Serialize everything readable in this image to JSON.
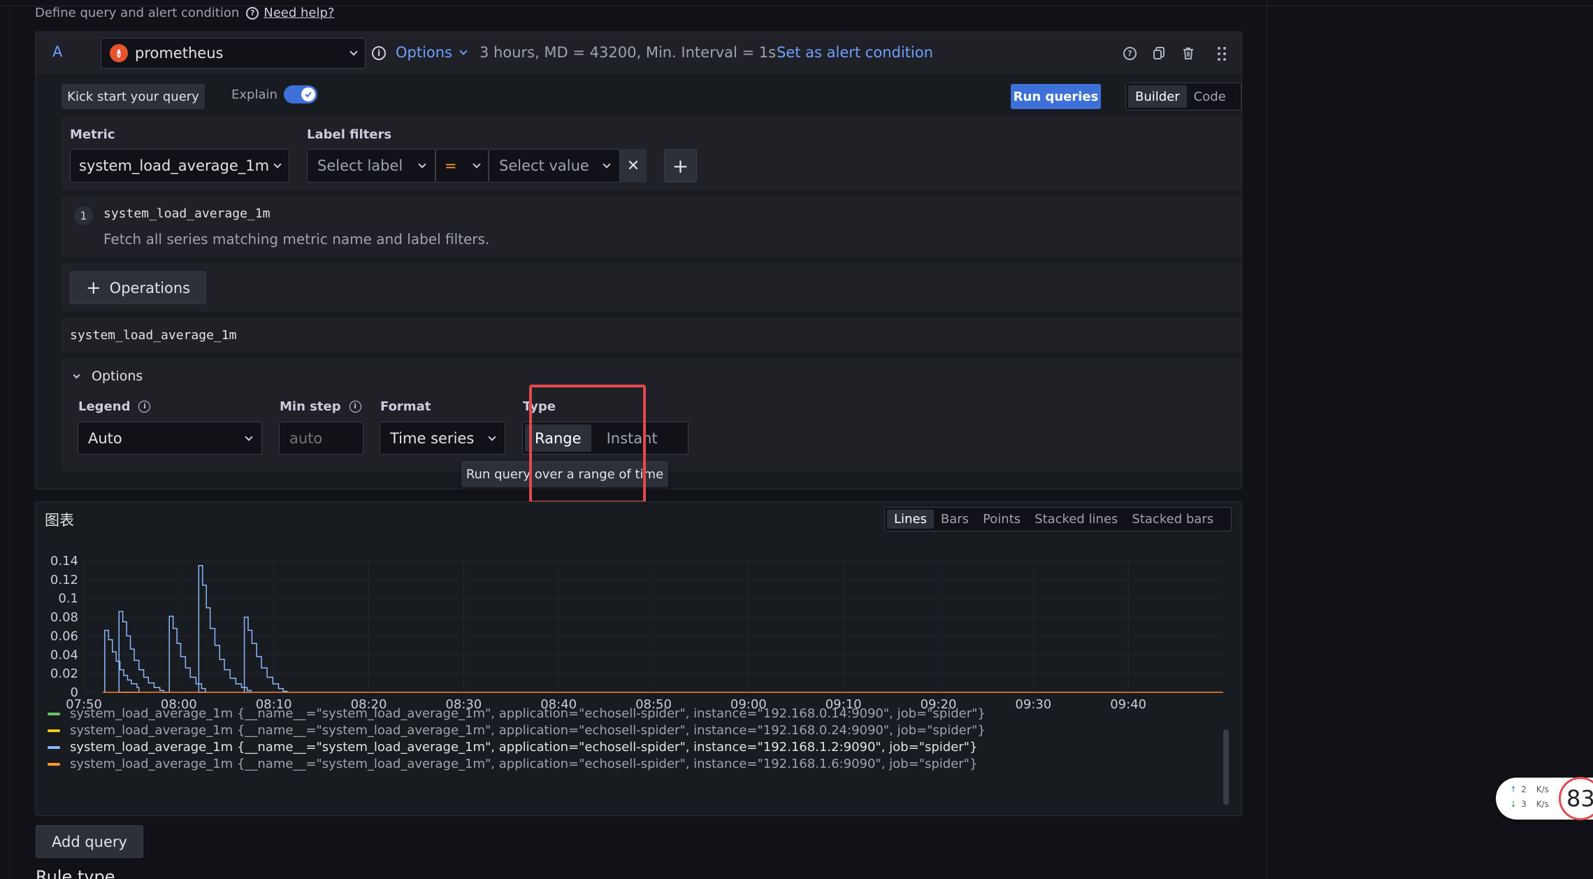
{
  "header": {
    "subtitle": "Define query and alert condition",
    "help_link": "Need help?"
  },
  "query": {
    "ref_id": "A",
    "datasource": "prometheus",
    "options_label": "Options",
    "options_summary": "3 hours, MD = 43200, Min. Interval = 1s",
    "alert_link": "Set as alert condition",
    "kickstart": "Kick start your query",
    "explain": "Explain",
    "run_queries": "Run queries",
    "builder": "Builder",
    "code": "Code",
    "metric_label": "Metric",
    "metric_value": "system_load_average_1m",
    "label_filters_label": "Label filters",
    "select_label": "Select label",
    "operator": "=",
    "select_value": "Select value",
    "explain_step_num": "1",
    "explain_step_code": "system_load_average_1m",
    "explain_step_desc": "Fetch all series matching metric name and label filters.",
    "operations": "Operations",
    "raw_query": "system_load_average_1m",
    "options_section": "Options",
    "legend_label": "Legend",
    "legend_value": "Auto",
    "minstep_label": "Min step",
    "minstep_placeholder": "auto",
    "format_label": "Format",
    "format_value": "Time series",
    "type_label": "Type",
    "type_range": "Range",
    "type_instant": "Instant",
    "tooltip": "Run query over a range of time"
  },
  "graph": {
    "title": "图表",
    "modes": [
      "Lines",
      "Bars",
      "Points",
      "Stacked lines",
      "Stacked bars"
    ],
    "active_mode": "Lines"
  },
  "chart_data": {
    "type": "line",
    "title": "",
    "xlabel": "",
    "ylabel": "",
    "ylim": [
      0,
      0.14
    ],
    "yticks": [
      "0.14",
      "0.12",
      "0.1",
      "0.08",
      "0.06",
      "0.04",
      "0.02",
      "0"
    ],
    "xticks": [
      "07:50",
      "08:00",
      "08:10",
      "08:20",
      "08:30",
      "08:40",
      "08:50",
      "09:00",
      "09:10",
      "09:20",
      "09:30",
      "09:40"
    ],
    "xrange_minutes": [
      0,
      120
    ],
    "series": [
      {
        "name": "system_load_average_1m {__name__=\"system_load_average_1m\", application=\"echosell-spider\", instance=\"192.168.1.2:9090\", job=\"spider\"}",
        "color": "#8ab8ff",
        "points": [
          [
            2.1,
            0
          ],
          [
            2.2,
            0.066
          ],
          [
            2.6,
            0.056
          ],
          [
            3.0,
            0.043
          ],
          [
            3.4,
            0.033
          ],
          [
            3.8,
            0.024
          ],
          [
            4.2,
            0.018
          ],
          [
            4.6,
            0.013
          ],
          [
            5.0,
            0.009
          ],
          [
            5.6,
            0.005
          ],
          [
            5.8,
            0
          ],
          [
            3.6,
            0
          ],
          [
            3.7,
            0.086
          ],
          [
            4.1,
            0.075
          ],
          [
            4.5,
            0.06
          ],
          [
            4.9,
            0.046
          ],
          [
            5.3,
            0.034
          ],
          [
            5.8,
            0.024
          ],
          [
            6.3,
            0.016
          ],
          [
            6.8,
            0.01
          ],
          [
            7.4,
            0.005
          ],
          [
            8.0,
            0.002
          ],
          [
            8.4,
            0
          ],
          [
            8.9,
            0
          ],
          [
            9.0,
            0.081
          ],
          [
            9.4,
            0.068
          ],
          [
            9.8,
            0.052
          ],
          [
            10.2,
            0.038
          ],
          [
            10.7,
            0.026
          ],
          [
            11.2,
            0.016
          ],
          [
            11.8,
            0.009
          ],
          [
            12.4,
            0.004
          ],
          [
            12.8,
            0
          ],
          [
            12.0,
            0
          ],
          [
            12.1,
            0.135
          ],
          [
            12.5,
            0.114
          ],
          [
            12.9,
            0.09
          ],
          [
            13.3,
            0.068
          ],
          [
            13.8,
            0.05
          ],
          [
            14.3,
            0.035
          ],
          [
            14.8,
            0.024
          ],
          [
            15.4,
            0.015
          ],
          [
            16.0,
            0.009
          ],
          [
            16.6,
            0.005
          ],
          [
            17.2,
            0.002
          ],
          [
            17.6,
            0
          ],
          [
            16.8,
            0
          ],
          [
            16.9,
            0.08
          ],
          [
            17.3,
            0.066
          ],
          [
            17.7,
            0.052
          ],
          [
            18.2,
            0.038
          ],
          [
            18.7,
            0.026
          ],
          [
            19.3,
            0.016
          ],
          [
            19.9,
            0.009
          ],
          [
            20.5,
            0.004
          ],
          [
            21.0,
            0.001
          ],
          [
            21.4,
            0
          ]
        ]
      },
      {
        "name": "system_load_average_1m {__name__=\"system_load_average_1m\", application=\"echosell-spider\", instance=\"192.168.1.6:9090\", job=\"spider\"}",
        "color": "#ff7f2a",
        "points": [
          [
            2,
            0
          ],
          [
            120,
            0
          ]
        ]
      }
    ]
  },
  "legend": [
    {
      "text": "system_load_average_1m {__name__=\"system_load_average_1m\", application=\"echosell-spider\", instance=\"192.168.0.14:9090\", job=\"spider\"}",
      "color": "#73bf69",
      "dim": true
    },
    {
      "text": "system_load_average_1m {__name__=\"system_load_average_1m\", application=\"echosell-spider\", instance=\"192.168.0.24:9090\", job=\"spider\"}",
      "color": "#f2cc0c",
      "dim": true
    },
    {
      "text": "system_load_average_1m {__name__=\"system_load_average_1m\", application=\"echosell-spider\", instance=\"192.168.1.2:9090\", job=\"spider\"}",
      "color": "#8ab8ff",
      "dim": false
    },
    {
      "text": "system_load_average_1m {__name__=\"system_load_average_1m\", application=\"echosell-spider\", instance=\"192.168.1.6:9090\", job=\"spider\"}",
      "color": "#ff9830",
      "dim": true
    }
  ],
  "footer": {
    "add_query": "Add query",
    "rule_type": "Rule type"
  },
  "netwidget": {
    "up": "2",
    "up_unit": "K/s",
    "down": "3",
    "down_unit": "K/s",
    "counter": "83"
  },
  "colors": {
    "accent": "#3d71d9",
    "highlight_box": "#e5484d",
    "datasource": "#e6522c"
  }
}
